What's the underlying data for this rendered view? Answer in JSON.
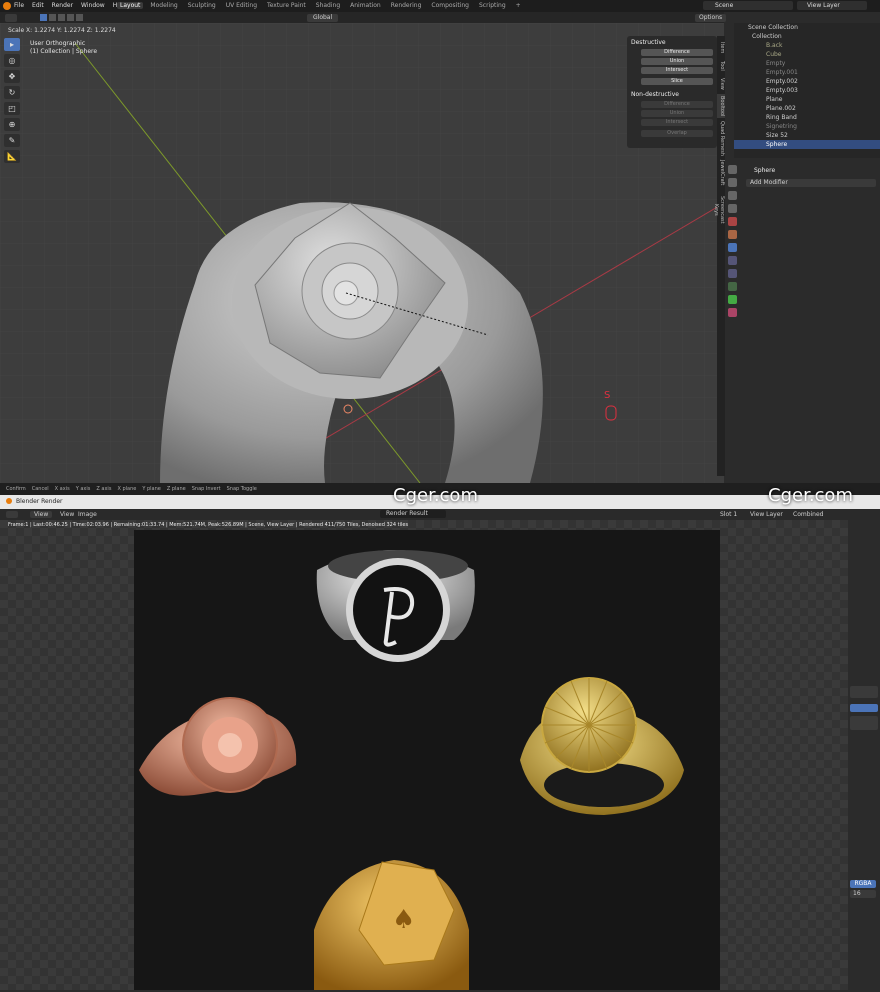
{
  "menu": [
    "File",
    "Edit",
    "Render",
    "Window",
    "Help"
  ],
  "workspaces": [
    "Layout",
    "Modeling",
    "Sculpting",
    "UV Editing",
    "Texture Paint",
    "Shading",
    "Animation",
    "Rendering",
    "Compositing",
    "Scripting"
  ],
  "scene": "Scene",
  "view_layer": "View Layer",
  "viewport": {
    "scale_readout": "Scale X: 1.2274  Y: 1.2274  Z: 1.2274",
    "view_name": "User Orthographic",
    "collection_info": "(1) Collection | Sphere",
    "orientation": "Global",
    "options": "Options",
    "axis_key": "S"
  },
  "bool_panel": {
    "destructive": "Destructive",
    "buttons": [
      "Difference",
      "Union",
      "Intersect",
      "Slice"
    ],
    "nondestructive": "Non-destructive",
    "nd_buttons": [
      "Difference",
      "Union",
      "Intersect",
      "Overlap"
    ]
  },
  "side_tabs": [
    "Item",
    "Tool",
    "View",
    "Booltool",
    "Quad Remesh",
    "JewelCraft",
    "Screencast Keys"
  ],
  "outliner": {
    "title": "Scene Collection",
    "items": [
      "Collection",
      "B.ack",
      "Cube",
      "Empty",
      "Empty.001",
      "Empty.002",
      "Empty.003",
      "Plane",
      "Plane.002",
      "Ring Band",
      "Signetring",
      "Size 52",
      "Sphere"
    ]
  },
  "properties": {
    "object": "Sphere",
    "add_modifier": "Add Modifier"
  },
  "statusbar": [
    "Confirm",
    "Cancel",
    "X axis",
    "Y axis",
    "Z axis",
    "X plane",
    "Y plane",
    "Z plane",
    "Snap Invert",
    "Snap Toggle"
  ],
  "render_window": {
    "title": "Blender Render",
    "menus": [
      "View",
      "View",
      "Image"
    ],
    "result": "Render Result",
    "slot": "Slot 1",
    "view_layer": "View Layer",
    "pass": "Combined",
    "info": "Frame:1 | Last:00:46.25 | Time:02:03.96 | Remaining:01:33.74 | Mem:521.74M, Peak:526.89M | Scene, View Layer | Rendered 411/750 Tiles, Denoised 324 tiles",
    "rgba": "RGBA",
    "depth": "16"
  },
  "watermark": "Cger.com",
  "colors": {
    "accent": "#4b74b8",
    "viewport_bg": "#3d3d3d",
    "render_bg": "#161616"
  }
}
